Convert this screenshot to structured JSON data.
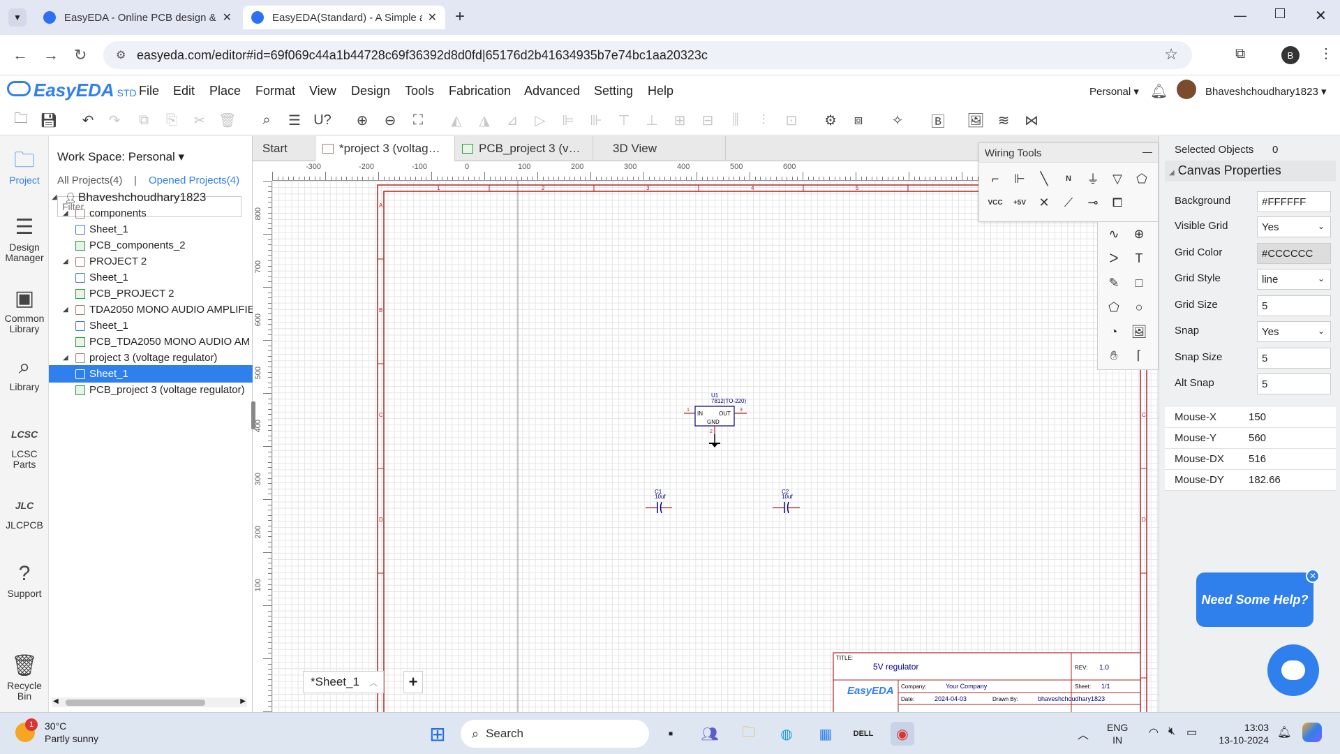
{
  "browser": {
    "tabs": [
      {
        "title": "EasyEDA - Online PCB design &",
        "active": false
      },
      {
        "title": "EasyEDA(Standard) - A Simple a",
        "active": true
      }
    ],
    "url": "easyeda.com/editor#id=69f069c44a1b44728c69f36392d8d0fd|65176d2b41634935b7e74bc1aa20323c",
    "profile_initial": "B"
  },
  "app": {
    "logo": "EasyEDA",
    "logo_suffix": "STD",
    "menus": [
      "File",
      "Edit",
      "Place",
      "Format",
      "View",
      "Design",
      "Tools",
      "Fabrication",
      "Advanced",
      "Setting",
      "Help"
    ],
    "workspace_selector": "Personal",
    "username": "Bhaveshchoudhary1823"
  },
  "left_rail": [
    {
      "label": "Project",
      "icon": "folder-icon",
      "active": true
    },
    {
      "label": "Design Manager",
      "icon": "list-icon"
    },
    {
      "label": "Common Library",
      "icon": "chip-icon"
    },
    {
      "label": "Library",
      "icon": "search-icon"
    },
    {
      "label": "LCSC Parts",
      "icon": "lcsc-icon"
    },
    {
      "label": "JLCPCB",
      "icon": "jlc-icon"
    },
    {
      "label": "Support",
      "icon": "question-icon"
    },
    {
      "label": "Recycle Bin",
      "icon": "trash-icon"
    }
  ],
  "project_panel": {
    "workspace_label": "Work Space: Personal",
    "all_projects": "All Projects(4)",
    "separator": "|",
    "opened_projects": "Opened Projects(4)",
    "filter_placeholder": "Filter",
    "tree": [
      {
        "label": "Bhaveshchoudhary1823",
        "level": 0,
        "type": "user"
      },
      {
        "label": "components",
        "level": 1,
        "type": "folder"
      },
      {
        "label": "Sheet_1",
        "level": 2,
        "type": "schematic"
      },
      {
        "label": "PCB_components_2",
        "level": 2,
        "type": "pcb"
      },
      {
        "label": "PROJECT 2",
        "level": 1,
        "type": "folder"
      },
      {
        "label": "Sheet_1",
        "level": 2,
        "type": "schematic"
      },
      {
        "label": "PCB_PROJECT 2",
        "level": 2,
        "type": "pcb"
      },
      {
        "label": "TDA2050 MONO AUDIO AMPLIFIE",
        "level": 1,
        "type": "folder"
      },
      {
        "label": "Sheet_1",
        "level": 2,
        "type": "schematic"
      },
      {
        "label": "PCB_TDA2050 MONO AUDIO AM",
        "level": 2,
        "type": "pcb"
      },
      {
        "label": "project 3 (voltage regulator)",
        "level": 1,
        "type": "folder"
      },
      {
        "label": "Sheet_1",
        "level": 2,
        "type": "schematic",
        "selected": true
      },
      {
        "label": "PCB_project 3 (voltage regulator)",
        "level": 2,
        "type": "pcb"
      }
    ]
  },
  "doc_tabs": [
    {
      "label": "Start"
    },
    {
      "label": "*project 3 (voltag…",
      "active": true
    },
    {
      "label": "PCB_project 3 (v…"
    },
    {
      "label": "3D View"
    }
  ],
  "rulers": {
    "top": [
      "-300",
      "-200",
      "-100",
      "0",
      "100",
      "200",
      "300",
      "400",
      "500",
      "600"
    ],
    "left": [
      "800",
      "700",
      "600",
      "500",
      "400",
      "300",
      "200",
      "100"
    ]
  },
  "frame": {
    "columns": [
      "1",
      "2",
      "3",
      "4",
      "5"
    ],
    "rows": [
      "A",
      "B",
      "C",
      "D"
    ]
  },
  "schematic": {
    "u1_ref": "U1",
    "u1_value": "7812(TO-220)",
    "u1_in": "IN",
    "u1_out": "OUT",
    "u1_gnd": "GND",
    "u1_pin1": "1",
    "u1_pin3": "3",
    "u1_pin2": "2",
    "c1_ref": "C1",
    "c1_value": "10uf",
    "c2_ref": "C2",
    "c2_value": "10uf"
  },
  "title_block": {
    "title_label": "TITLE:",
    "title": "5V regulator",
    "rev_label": "REV:",
    "rev": "1.0",
    "logo": "EasyEDA",
    "company_label": "Company:",
    "company": "Your Company",
    "sheet_label": "Sheet:",
    "sheet": "1/1",
    "date_label": "Date:",
    "date": "2024-04-03",
    "drawn_label": "Drawn By:",
    "drawn": "bhaveshchoudhary1823"
  },
  "sheet_tab": {
    "label": "*Sheet_1",
    "add": "+"
  },
  "wiring_tools": {
    "title": "Wiring Tools",
    "minimize": "—"
  },
  "properties": {
    "selected_label": "Selected Objects",
    "selected_count": "0",
    "section": "Canvas Properties",
    "fields": [
      {
        "label": "Background",
        "value": "#FFFFFF",
        "type": "text"
      },
      {
        "label": "Visible Grid",
        "value": "Yes",
        "type": "select"
      },
      {
        "label": "Grid Color",
        "value": "#CCCCCC",
        "type": "color"
      },
      {
        "label": "Grid Style",
        "value": "line",
        "type": "select"
      },
      {
        "label": "Grid Size",
        "value": "5",
        "type": "text"
      },
      {
        "label": "Snap",
        "value": "Yes",
        "type": "select"
      },
      {
        "label": "Snap Size",
        "value": "5",
        "type": "text"
      },
      {
        "label": "Alt Snap",
        "value": "5",
        "type": "text"
      }
    ],
    "mouse": [
      {
        "label": "Mouse-X",
        "value": "150"
      },
      {
        "label": "Mouse-Y",
        "value": "560"
      },
      {
        "label": "Mouse-DX",
        "value": "516"
      },
      {
        "label": "Mouse-DY",
        "value": "182.66"
      }
    ]
  },
  "help_bubble": "Need Some Help?",
  "taskbar": {
    "weather_temp": "30°C",
    "weather_desc": "Partly sunny",
    "weather_badge": "1",
    "search": "Search",
    "lang": "ENG",
    "region": "IN",
    "time": "13:03",
    "date": "13-10-2024"
  },
  "colors": {
    "accent": "#2f80ed",
    "frame": "#b22222",
    "schematic": "#000080"
  }
}
